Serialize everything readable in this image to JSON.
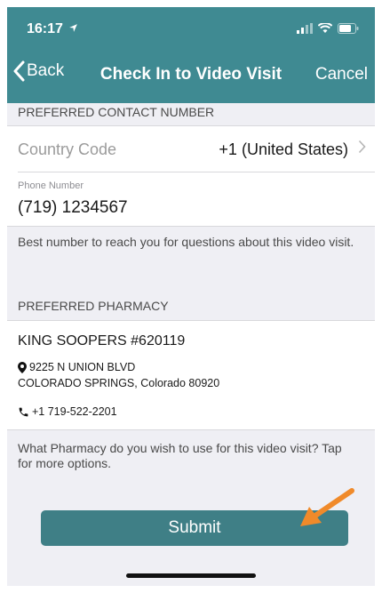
{
  "status_bar": {
    "time": "16:17"
  },
  "nav": {
    "back_label": "Back",
    "title": "Check In to Video Visit",
    "cancel_label": "Cancel"
  },
  "contact": {
    "section_title": "PREFERRED CONTACT NUMBER",
    "country_code_label": "Country Code",
    "country_code_value": "+1 (United States)",
    "phone_label": "Phone Number",
    "phone_value": "(719) 1234567",
    "help_text": "Best number to reach you for questions about this video visit."
  },
  "pharmacy": {
    "section_title": "PREFERRED PHARMACY",
    "name": "KING SOOPERS #620119",
    "address_line1": "9225 N UNION BLVD",
    "address_line2": "COLORADO SPRINGS, Colorado  80920",
    "phone": "+1 719-522-2201",
    "help_text": "What Pharmacy do you wish to use for this video visit? Tap for more options."
  },
  "submit_label": "Submit",
  "colors": {
    "header": "#3f8a92",
    "submit": "#3f7f86",
    "arrow": "#f08a2a",
    "background": "#efeff4"
  }
}
